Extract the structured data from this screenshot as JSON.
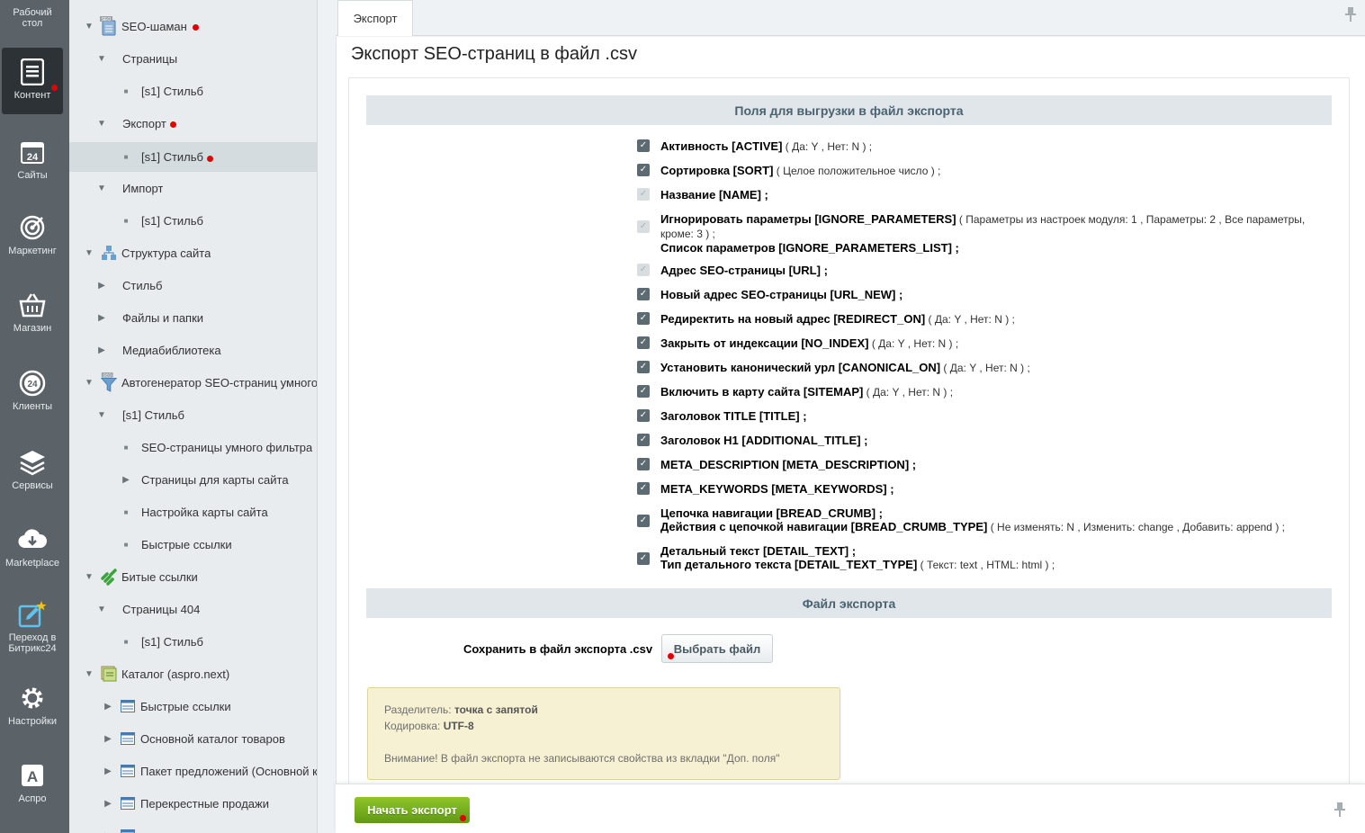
{
  "rail": [
    {
      "label": "Рабочий стол",
      "icon": "desktop-icon"
    },
    {
      "label": "Контент",
      "icon": "document-icon"
    },
    {
      "label": "Сайты",
      "icon": "calendar-24-icon"
    },
    {
      "label": "Маркетинг",
      "icon": "target-icon"
    },
    {
      "label": "Магазин",
      "icon": "basket-icon"
    },
    {
      "label": "Клиенты",
      "icon": "clients-24-icon"
    },
    {
      "label": "Сервисы",
      "icon": "layers-icon"
    },
    {
      "label": "Marketplace",
      "icon": "cloud-download-icon"
    },
    {
      "label": "Переход в Битрикс24",
      "icon": "edit-star-icon"
    },
    {
      "label": "Настройки",
      "icon": "gear-icon"
    },
    {
      "label": "Аспро",
      "icon": "letter-a-icon"
    }
  ],
  "tree": [
    {
      "label": "SEO-шаман"
    },
    {
      "label": "Страницы"
    },
    {
      "label": "[s1] Стильб"
    },
    {
      "label": "Экспорт"
    },
    {
      "label": "[s1] Стильб"
    },
    {
      "label": "Импорт"
    },
    {
      "label": "[s1] Стильб"
    },
    {
      "label": "Структура сайта"
    },
    {
      "label": "Стильб"
    },
    {
      "label": "Файлы и папки"
    },
    {
      "label": "Медиабиблиотека"
    },
    {
      "label": "Автогенератор SEO-страниц умного"
    },
    {
      "label": "[s1] Стильб"
    },
    {
      "label": "SEO-страницы умного фильтра"
    },
    {
      "label": "Страницы для карты сайта"
    },
    {
      "label": "Настройка карты сайта"
    },
    {
      "label": "Быстрые ссылки"
    },
    {
      "label": "Битые ссылки"
    },
    {
      "label": "Страницы 404"
    },
    {
      "label": "[s1] Стильб"
    },
    {
      "label": "Каталог (aspro.next)"
    },
    {
      "label": "Быстрые ссылки"
    },
    {
      "label": "Основной каталог товаров"
    },
    {
      "label": "Пакет предложений (Основной к"
    },
    {
      "label": "Перекрестные продажи"
    }
  ],
  "tab": {
    "label": "Экспорт"
  },
  "page": {
    "title": "Экспорт SEO-страниц в файл .csv"
  },
  "sections": {
    "fields_head": "Поля для выгрузки в файл экспорта",
    "file_head": "Файл экспорта"
  },
  "fields": [
    {
      "name": "Активность [ACTIVE]",
      "hint_open": " ( Да: ",
      "v1": "Y",
      "hint_mid": " , Нет: ",
      "v2": "N",
      "hint_close": "  ) ;",
      "checked": true
    },
    {
      "name": "Сортировка [SORT]",
      "hint_open": " ( Целое положительное число ) ;",
      "checked": true
    },
    {
      "name": "Название [NAME] ;",
      "checked": true,
      "disabled": true
    },
    {
      "name": "Игнорировать параметры [IGNORE_PARAMETERS]",
      "hint_open": " ( Параметры из настроек модуля: ",
      "v1": "1",
      "hint_mid": " , Параметры: ",
      "v2": "2",
      "hint_mid2": " , Все параметры, кроме: ",
      "v3": "3",
      "hint_close": " ) ;",
      "line2": "Список параметров [IGNORE_PARAMETERS_LIST] ;",
      "checked": true,
      "disabled": true
    },
    {
      "name": "Адрес SEO-страницы [URL] ;",
      "checked": true,
      "disabled": true
    },
    {
      "name": "Новый адрес SEO-страницы [URL_NEW] ;",
      "checked": true
    },
    {
      "name": "Редиректить на новый адрес [REDIRECT_ON]",
      "hint_open": " ( Да: ",
      "v1": "Y",
      "hint_mid": " , Нет: ",
      "v2": "N",
      "hint_close": " ) ;",
      "checked": true
    },
    {
      "name": "Закрыть от индексации [NO_INDEX]",
      "hint_open": " ( Да: ",
      "v1": "Y",
      "hint_mid": " , Нет: ",
      "v2": "N",
      "hint_close": "  ) ;",
      "checked": true
    },
    {
      "name": "Установить канонический урл [CANONICAL_ON]",
      "hint_open": " ( Да: ",
      "v1": "Y",
      "hint_mid": " , Нет: ",
      "v2": "N",
      "hint_close": "  ) ;",
      "checked": true
    },
    {
      "name": "Включить в карту сайта [SITEMAP]",
      "hint_open": " ( Да: ",
      "v1": "Y",
      "hint_mid": " , Нет: ",
      "v2": "N",
      "hint_close": "  ) ;",
      "checked": true
    },
    {
      "name": "Заголовок TITLE [TITLE] ;",
      "checked": true
    },
    {
      "name": "Заголовок H1 [ADDITIONAL_TITLE] ;",
      "checked": true
    },
    {
      "name": "META_DESCRIPTION [META_DESCRIPTION] ;",
      "checked": true
    },
    {
      "name": "META_KEYWORDS [META_KEYWORDS] ;",
      "checked": true
    },
    {
      "name": "Цепочка навигации [BREAD_CRUMB] ;",
      "line2": "Действия с цепочкой навигации [BREAD_CRUMB_TYPE]",
      "hint_open": " ( Не изменять: ",
      "v1": "N",
      "hint_mid": " , Изменить: ",
      "v2": "change",
      "hint_mid2": " , Добавить: ",
      "v3": "append",
      "hint_close": "  ) ;",
      "checked": true
    },
    {
      "name": "Детальный текст [DETAIL_TEXT] ;",
      "line2": "Тип детального текста [DETAIL_TEXT_TYPE]",
      "hint_open": " ( Текст: ",
      "v1": "text",
      "hint_mid": " , HTML: ",
      "v2": "html",
      "hint_close": "  ) ;",
      "checked": true
    }
  ],
  "file": {
    "save_label": "Сохранить в файл экспорта .csv",
    "button_label": "Выбрать файл"
  },
  "note": {
    "sep_label": "Разделитель: ",
    "sep_value": "точка с запятой",
    "enc_label": "Кодировка: ",
    "enc_value": "UTF-8",
    "warning": "Внимание! В файл экспорта не записываются свойства из вкладки \"Доп. поля\""
  },
  "actions": {
    "start_label": "Начать экспорт"
  },
  "colors": {
    "accent_green": "#6aa51b",
    "marker_red": "#e30000",
    "rail_bg": "#5b6268"
  }
}
